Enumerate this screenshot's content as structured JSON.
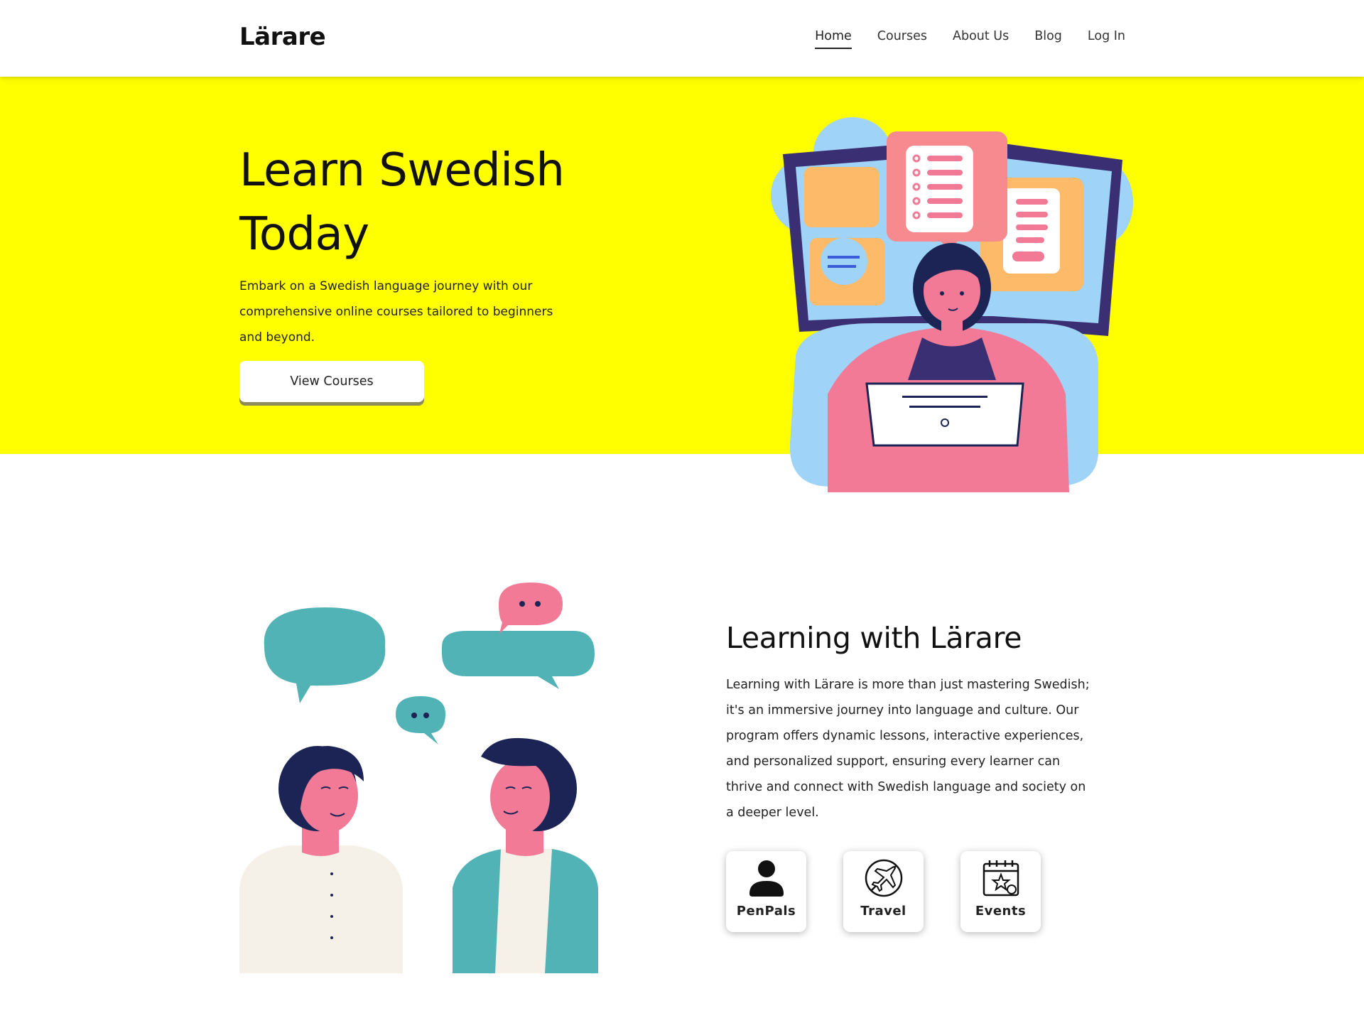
{
  "header": {
    "logo": "Lärare",
    "nav": [
      {
        "label": "Home",
        "active": true
      },
      {
        "label": "Courses",
        "active": false
      },
      {
        "label": "About Us",
        "active": false
      },
      {
        "label": "Blog",
        "active": false
      },
      {
        "label": "Log In",
        "active": false
      }
    ]
  },
  "hero": {
    "title": "Learn Swedish Today",
    "text": "Embark on a Swedish language journey with our comprehensive online courses tailored to beginners and beyond.",
    "button_label": "View Courses",
    "background_color": "#ffff00"
  },
  "learning": {
    "title": "Learning with Lärare",
    "text": "Learning with Lärare is more than just mastering Swedish; it's an immersive journey into language and culture. Our program offers dynamic lessons, interactive experiences, and personalized support, ensuring every learner can thrive and connect with Swedish language and society on a deeper level.",
    "features": [
      {
        "label": "PenPals",
        "icon": "person-icon"
      },
      {
        "label": "Travel",
        "icon": "plane-icon"
      },
      {
        "label": "Events",
        "icon": "calendar-star-icon"
      }
    ]
  },
  "colors": {
    "accent": "#ffff00",
    "teal": "#52b3b6",
    "pink": "#f27a96",
    "navy": "#1c2456",
    "light_blue": "#9fd3f7"
  }
}
